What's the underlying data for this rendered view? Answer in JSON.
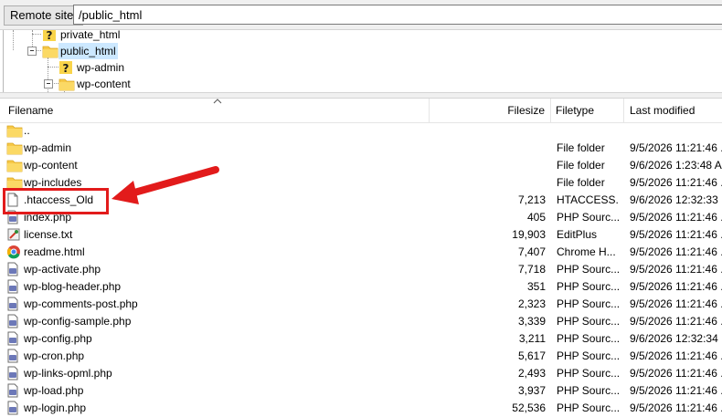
{
  "remote_site": {
    "label": "Remote site:",
    "path": "/public_html"
  },
  "tree": {
    "nodes": [
      {
        "label": "private_html",
        "icon": "unknown-folder-icon"
      },
      {
        "label": "public_html",
        "icon": "folder-icon"
      },
      {
        "label": "wp-admin",
        "icon": "unknown-folder-icon"
      },
      {
        "label": "wp-content",
        "icon": "folder-icon"
      }
    ]
  },
  "columns": {
    "filename": "Filename",
    "filesize": "Filesize",
    "filetype": "Filetype",
    "last_modified": "Last modified"
  },
  "files": [
    {
      "name": "..",
      "size": "",
      "type": "",
      "modified": "",
      "icon": "folder-icon"
    },
    {
      "name": "wp-admin",
      "size": "",
      "type": "File folder",
      "modified": "9/5/2026 11:21:46 ...",
      "icon": "folder-icon"
    },
    {
      "name": "wp-content",
      "size": "",
      "type": "File folder",
      "modified": "9/6/2026 1:23:48 A...",
      "icon": "folder-icon"
    },
    {
      "name": "wp-includes",
      "size": "",
      "type": "File folder",
      "modified": "9/5/2026 11:21:46 ...",
      "icon": "folder-icon"
    },
    {
      "name": ".htaccess_Old",
      "size": "7,213",
      "type": "HTACCESS...",
      "modified": "9/6/2026 12:32:33 ...",
      "icon": "blank-file-icon"
    },
    {
      "name": "index.php",
      "size": "405",
      "type": "PHP Sourc...",
      "modified": "9/5/2026 11:21:46 ...",
      "icon": "php-file-icon"
    },
    {
      "name": "license.txt",
      "size": "19,903",
      "type": "EditPlus",
      "modified": "9/5/2026 11:21:46 ...",
      "icon": "editplus-file-icon"
    },
    {
      "name": "readme.html",
      "size": "7,407",
      "type": "Chrome H...",
      "modified": "9/5/2026 11:21:46 ...",
      "icon": "chrome-html-icon"
    },
    {
      "name": "wp-activate.php",
      "size": "7,718",
      "type": "PHP Sourc...",
      "modified": "9/5/2026 11:21:46 ...",
      "icon": "php-file-icon"
    },
    {
      "name": "wp-blog-header.php",
      "size": "351",
      "type": "PHP Sourc...",
      "modified": "9/5/2026 11:21:46 ...",
      "icon": "php-file-icon"
    },
    {
      "name": "wp-comments-post.php",
      "size": "2,323",
      "type": "PHP Sourc...",
      "modified": "9/5/2026 11:21:46 ...",
      "icon": "php-file-icon"
    },
    {
      "name": "wp-config-sample.php",
      "size": "3,339",
      "type": "PHP Sourc...",
      "modified": "9/5/2026 11:21:46 ...",
      "icon": "php-file-icon"
    },
    {
      "name": "wp-config.php",
      "size": "3,211",
      "type": "PHP Sourc...",
      "modified": "9/6/2026 12:32:34 ...",
      "icon": "php-file-icon"
    },
    {
      "name": "wp-cron.php",
      "size": "5,617",
      "type": "PHP Sourc...",
      "modified": "9/5/2026 11:21:46 ...",
      "icon": "php-file-icon"
    },
    {
      "name": "wp-links-opml.php",
      "size": "2,493",
      "type": "PHP Sourc...",
      "modified": "9/5/2026 11:21:46 ...",
      "icon": "php-file-icon"
    },
    {
      "name": "wp-load.php",
      "size": "3,937",
      "type": "PHP Sourc...",
      "modified": "9/5/2026 11:21:46 ...",
      "icon": "php-file-icon"
    },
    {
      "name": "wp-login.php",
      "size": "52,536",
      "type": "PHP Sourc...",
      "modified": "9/5/2026 11:21:46 ...",
      "icon": "php-file-icon"
    }
  ],
  "annotation": {
    "highlight_color": "#e21b1b",
    "highlighted_file": ".htaccess_Old"
  },
  "colors": {
    "folder": "#f7c948",
    "selection": "#cce8ff",
    "accent_red": "#e21b1b"
  }
}
